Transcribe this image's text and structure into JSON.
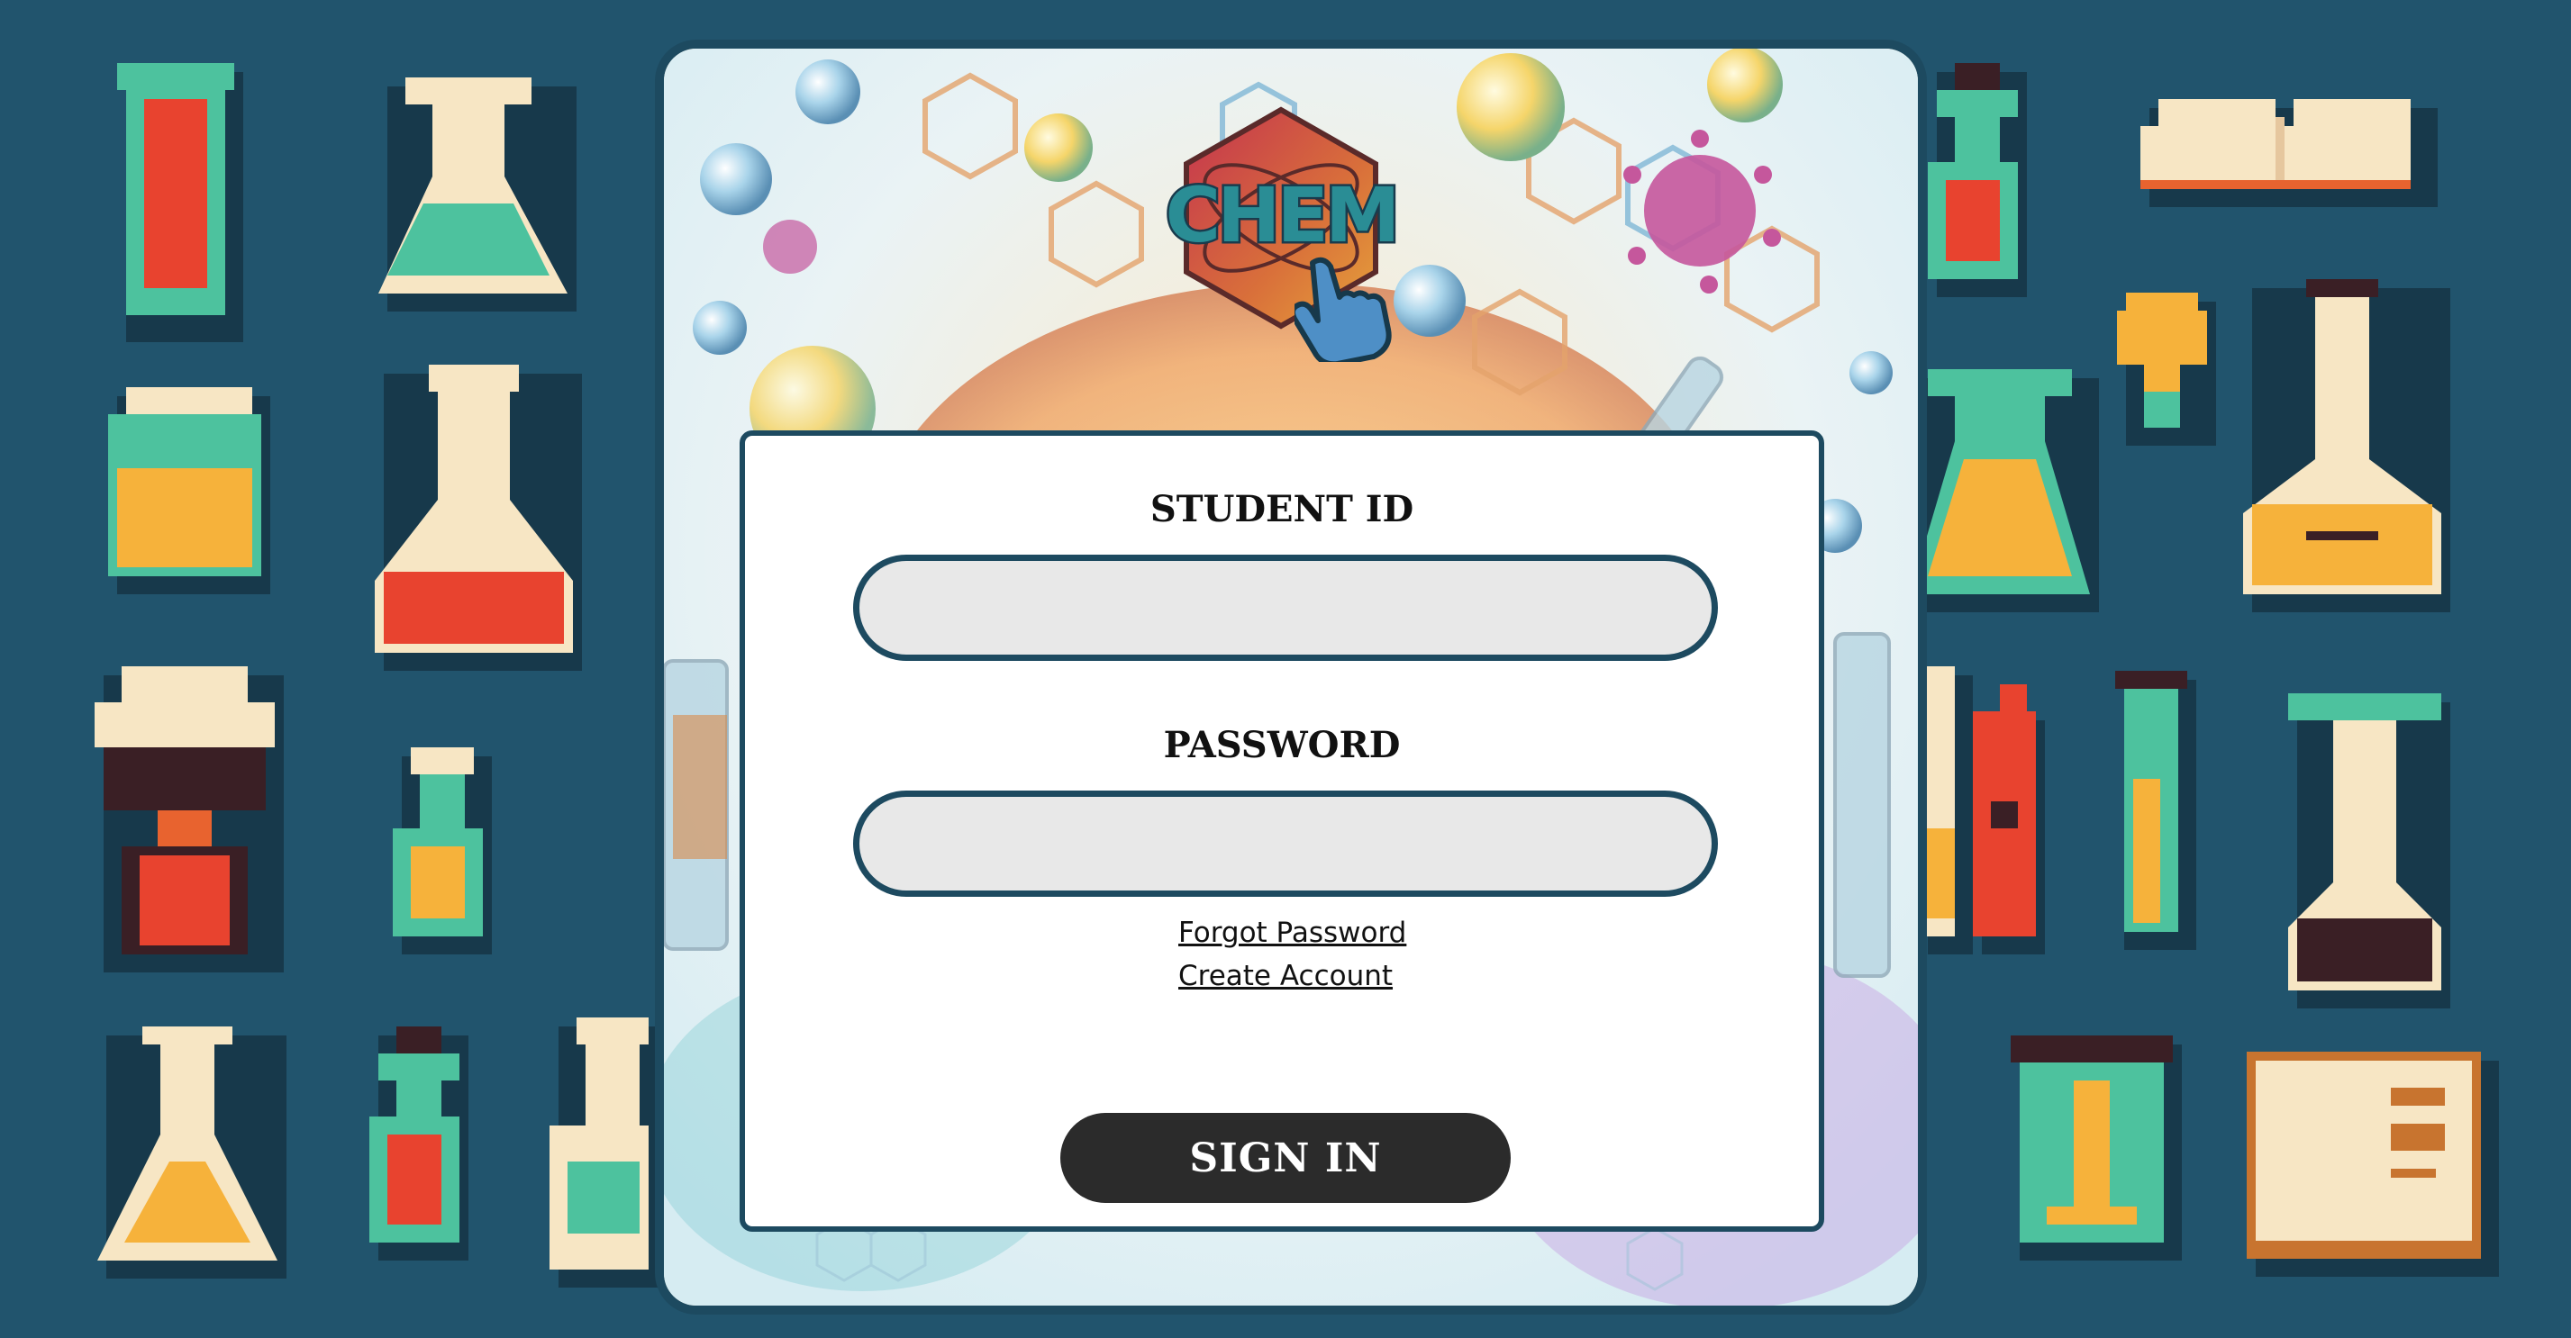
{
  "logo": {
    "text": "CHEM"
  },
  "form": {
    "student_id_label": "STUDENT ID",
    "student_id_value": "",
    "password_label": "PASSWORD",
    "password_value": "",
    "forgot_password": "Forgot Password",
    "create_account": "Create Account",
    "sign_in": "SIGN IN"
  },
  "colors": {
    "background": "#21546d",
    "border": "#1d4a60",
    "input_fill": "#e8e8e8",
    "button": "#2b2b2b"
  },
  "icons": [
    "test-tube-icon",
    "flask-icon",
    "jar-icon",
    "book-icon",
    "pointer-hand-icon",
    "virus-icon"
  ]
}
